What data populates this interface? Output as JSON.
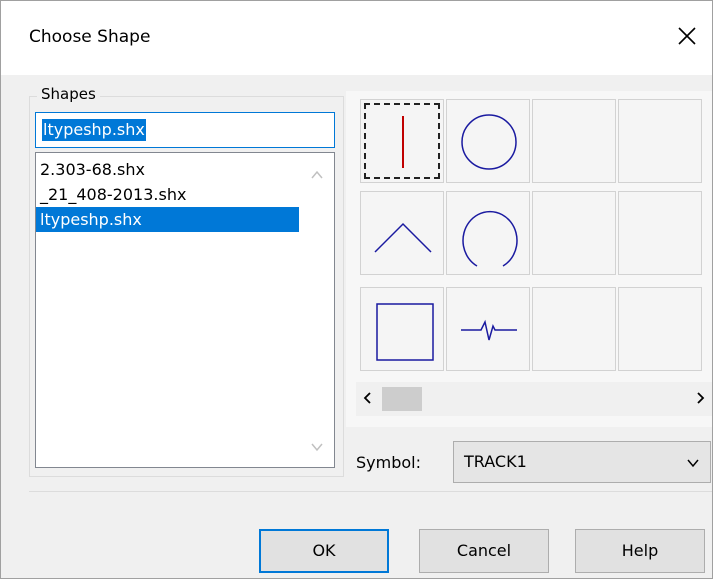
{
  "dialog": {
    "title": "Choose Shape"
  },
  "shapes": {
    "group_label": "Shapes",
    "input_value": "ltypeshp.shx",
    "items": [
      "2.303-68.shx",
      "_21_408-2013.shx",
      "ltypeshp.shx"
    ],
    "selected_index": 2
  },
  "grid": {
    "cells": [
      {
        "icon": "vertical-line-icon"
      },
      {
        "icon": "circle-icon"
      },
      {
        "icon": "empty"
      },
      {
        "icon": "empty"
      },
      {
        "icon": "chevron-up-icon"
      },
      {
        "icon": "horseshoe-icon"
      },
      {
        "icon": "empty"
      },
      {
        "icon": "empty"
      },
      {
        "icon": "square-icon"
      },
      {
        "icon": "track-icon"
      },
      {
        "icon": "empty"
      },
      {
        "icon": "empty"
      }
    ],
    "focused_index": 0
  },
  "symbol": {
    "label": "Symbol:",
    "value": "TRACK1"
  },
  "buttons": {
    "ok": "OK",
    "cancel": "Cancel",
    "help": "Help"
  },
  "colors": {
    "accent": "#0078d7",
    "shape_stroke": "#1a1aa0",
    "line_red": "#c00000"
  }
}
